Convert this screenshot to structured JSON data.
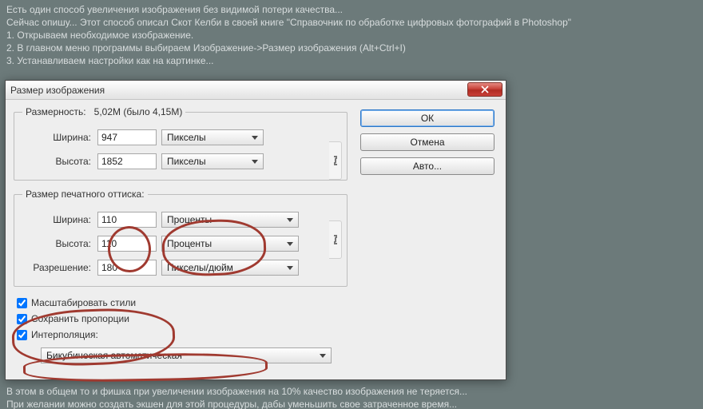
{
  "background": {
    "line1": "Есть один способ увеличения изображения без видимой потери качества...",
    "line2": "Сейчас опишу... Этот способ описал Скот Келби в своей книге \"Справочник по обработке цифровых фотографий в Photoshop\"",
    "line3": "1. Открываем необходимое изображение.",
    "line4": "2. В главном меню программы выбираем Изображение->Размер изображения (Alt+Ctrl+I)",
    "line5": "3. Устанавливаем настройки как на картинке...",
    "line6": "В этом в общем то и фишка при увеличении изображения на 10% качество изображения не теряется...",
    "line7": "При желании можно создать экшен для этой процедуры, дабы уменьшить свое затраченное время..."
  },
  "dialog": {
    "title": "Размер изображения",
    "pixel_dim": {
      "legend": "Размерность:",
      "summary": "5,02M (было 4,15M)",
      "width_label": "Ширина:",
      "width_value": "947",
      "height_label": "Высота:",
      "height_value": "1852",
      "unit": "Пикселы"
    },
    "doc_size": {
      "legend": "Размер печатного оттиска:",
      "width_label": "Ширина:",
      "width_value": "110",
      "height_label": "Высота:",
      "height_value": "110",
      "unit": "Проценты",
      "res_label": "Разрешение:",
      "res_value": "180",
      "res_unit": "Пикселы/дюйм"
    },
    "checks": {
      "scale_styles": "Масштабировать стили",
      "constrain": "Сохранить пропорции",
      "resample": "Интерполяция:"
    },
    "interp_method": "Бикубическая автоматическая",
    "buttons": {
      "ok": "ОК",
      "cancel": "Отмена",
      "auto": "Авто..."
    }
  }
}
